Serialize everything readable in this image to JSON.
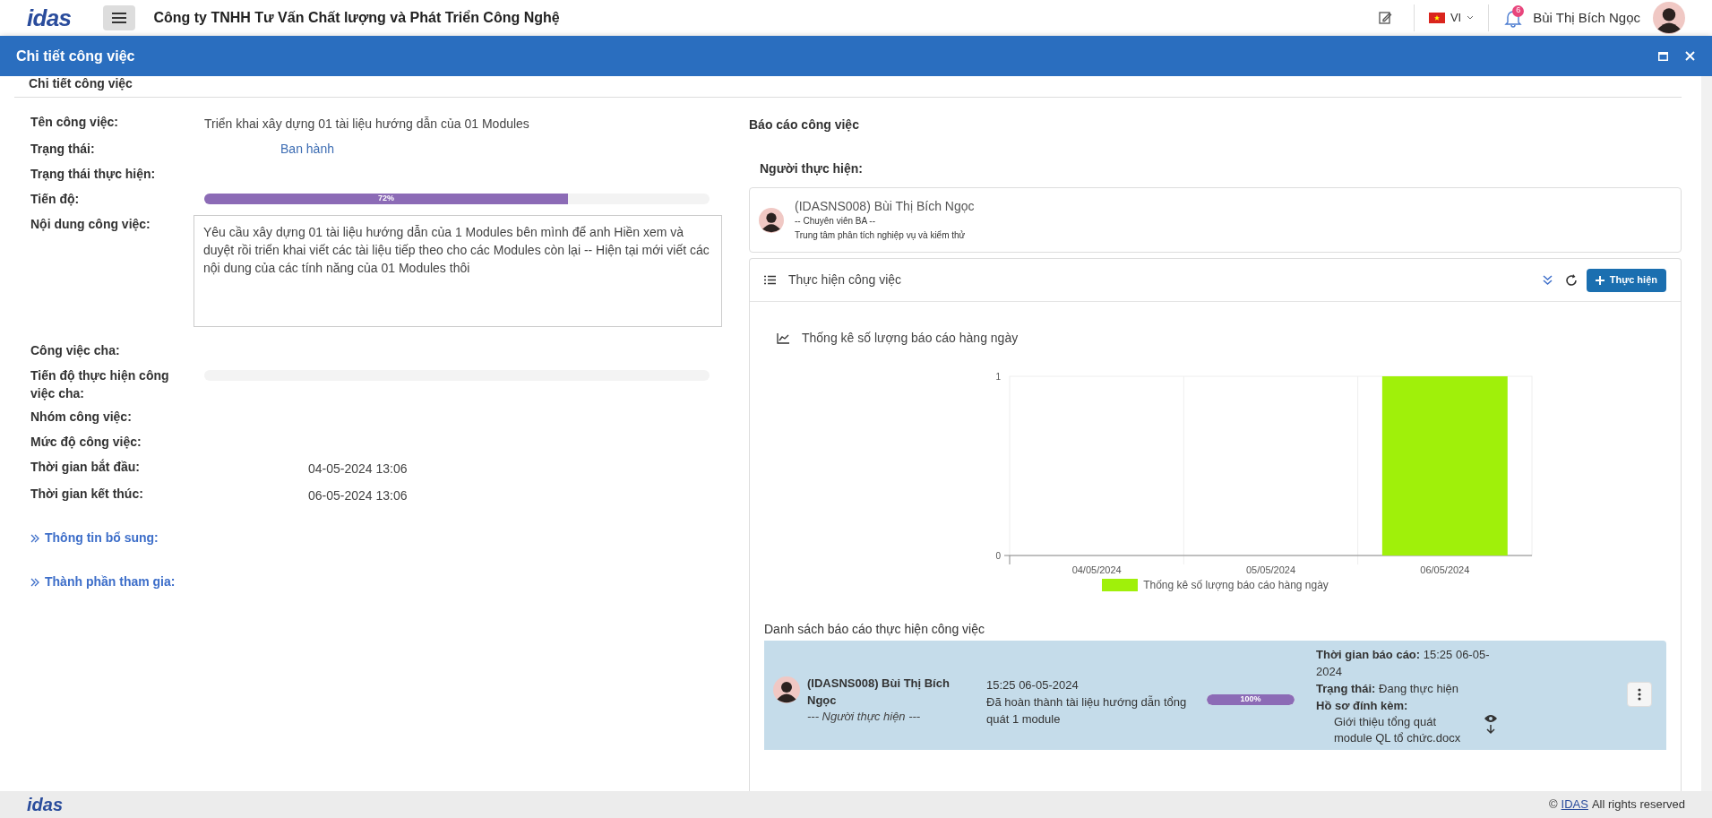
{
  "topbar": {
    "logo": "idas",
    "company": "Công ty TNHH Tư Vấn Chất lượng và Phát Triển Công Nghệ",
    "language": "VI",
    "notification_count": "6",
    "user_name": "Bùi Thị Bích Ngọc"
  },
  "modal": {
    "title": "Chi tiết công việc",
    "section_title": "Chi tiết công việc"
  },
  "details": [
    {
      "kind": "text",
      "label": "Tên công việc:",
      "value": "Triển khai xây dựng 01 tài liệu hướng dẫn của 01 Modules"
    },
    {
      "kind": "status",
      "label": "Trạng thái:",
      "value": "Ban hành"
    },
    {
      "kind": "empty",
      "label": "Trạng thái thực hiện:"
    },
    {
      "kind": "progress",
      "label": "Tiến độ:",
      "value": "72%",
      "level": 0.72
    },
    {
      "kind": "textarea",
      "label": "Nội dung công việc:",
      "value": "Yêu cầu xây dựng 01 tài liệu hướng dẫn của 1 Modules bên mình để anh Hiền xem và duyệt rồi triển khai viết các tài liệu tiếp theo cho các Modules còn lại -- Hiện tại mới viết các nội dung của các tính năng của 01 Modules thôi"
    },
    {
      "kind": "empty",
      "label": "Công việc cha:"
    },
    {
      "kind": "progress",
      "label": "Tiến độ thực hiện công việc cha:",
      "level": 0
    },
    {
      "kind": "empty",
      "label": "Nhóm công việc:"
    },
    {
      "kind": "empty",
      "label": "Mức độ công việc:"
    },
    {
      "kind": "date",
      "label": "Thời gian bắt đầu:",
      "value": "04-05-2024 13:06"
    },
    {
      "kind": "date",
      "label": "Thời gian kết thúc:",
      "value": "06-05-2024 13:06"
    }
  ],
  "extra_sections": [
    "Thông tin bổ sung:",
    "Thành phần tham gia:"
  ],
  "report": {
    "title": "Báo cáo công việc",
    "assignee_label": "Người thực hiện:",
    "assignee": {
      "name": "(IDASNS008) Bùi Thị Bích Ngọc",
      "position": "-- Chuyên viên BA --",
      "department": "Trung tâm phân tích nghiệp vụ và kiểm thử"
    },
    "panel_title": "Thực hiện công việc",
    "action_button": "Thực hiện",
    "chart_title": "Thống kê số lượng báo cáo hàng ngày",
    "chart_data": {
      "type": "bar",
      "categories": [
        "04/05/2024",
        "05/05/2024",
        "06/05/2024"
      ],
      "series": [
        {
          "name": "Thống kê số lượng báo cáo hàng ngày",
          "color": "#a0f00a",
          "values": [
            0,
            0,
            1
          ]
        }
      ],
      "ylim": [
        0,
        1
      ],
      "yticks": [
        0,
        1
      ]
    },
    "list_title": "Danh sách báo cáo thực hiện công việc",
    "reports": [
      {
        "name": "(IDASNS008) Bùi Thị Bích Ngọc",
        "role": "--- Người thực hiện ---",
        "time": "15:25 06-05-2024",
        "content": "Đã hoàn thành tài liệu hướng dẫn tổng quát 1 module",
        "progress": "100%",
        "level": 1,
        "report_time": "**Thời gian báo cáo:** 15:25 06-05-2024",
        "status": "**Trạng thái:** Đang thực hiện",
        "attachments_label": "Hồ sơ đính kèm:",
        "attachments": [
          "Giới thiệu tổng quát module QL tổ chức.docx"
        ]
      }
    ]
  },
  "footer": {
    "logo": "idas",
    "prefix": "©",
    "link": "IDAS",
    "suffix": "All rights reserved"
  }
}
